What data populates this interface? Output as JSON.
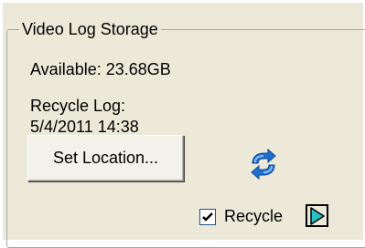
{
  "group": {
    "title": "Video Log Storage"
  },
  "storage": {
    "available_text": "Available: 23.68GB",
    "recycle_log_label": "Recycle Log:",
    "recycle_log_time": "5/4/2011 14:38"
  },
  "buttons": {
    "set_location_label": "Set Location..."
  },
  "recycle": {
    "label": "Recycle",
    "checked": true
  },
  "icons": {
    "refresh": "refresh-icon",
    "play": "play-icon",
    "check": "checkmark-icon"
  },
  "colors": {
    "panel_bg": "#ece9d8",
    "group_border": "#a7a6aa",
    "refresh_blue": "#1e6fd0",
    "play_teal": "#25c3c5"
  }
}
